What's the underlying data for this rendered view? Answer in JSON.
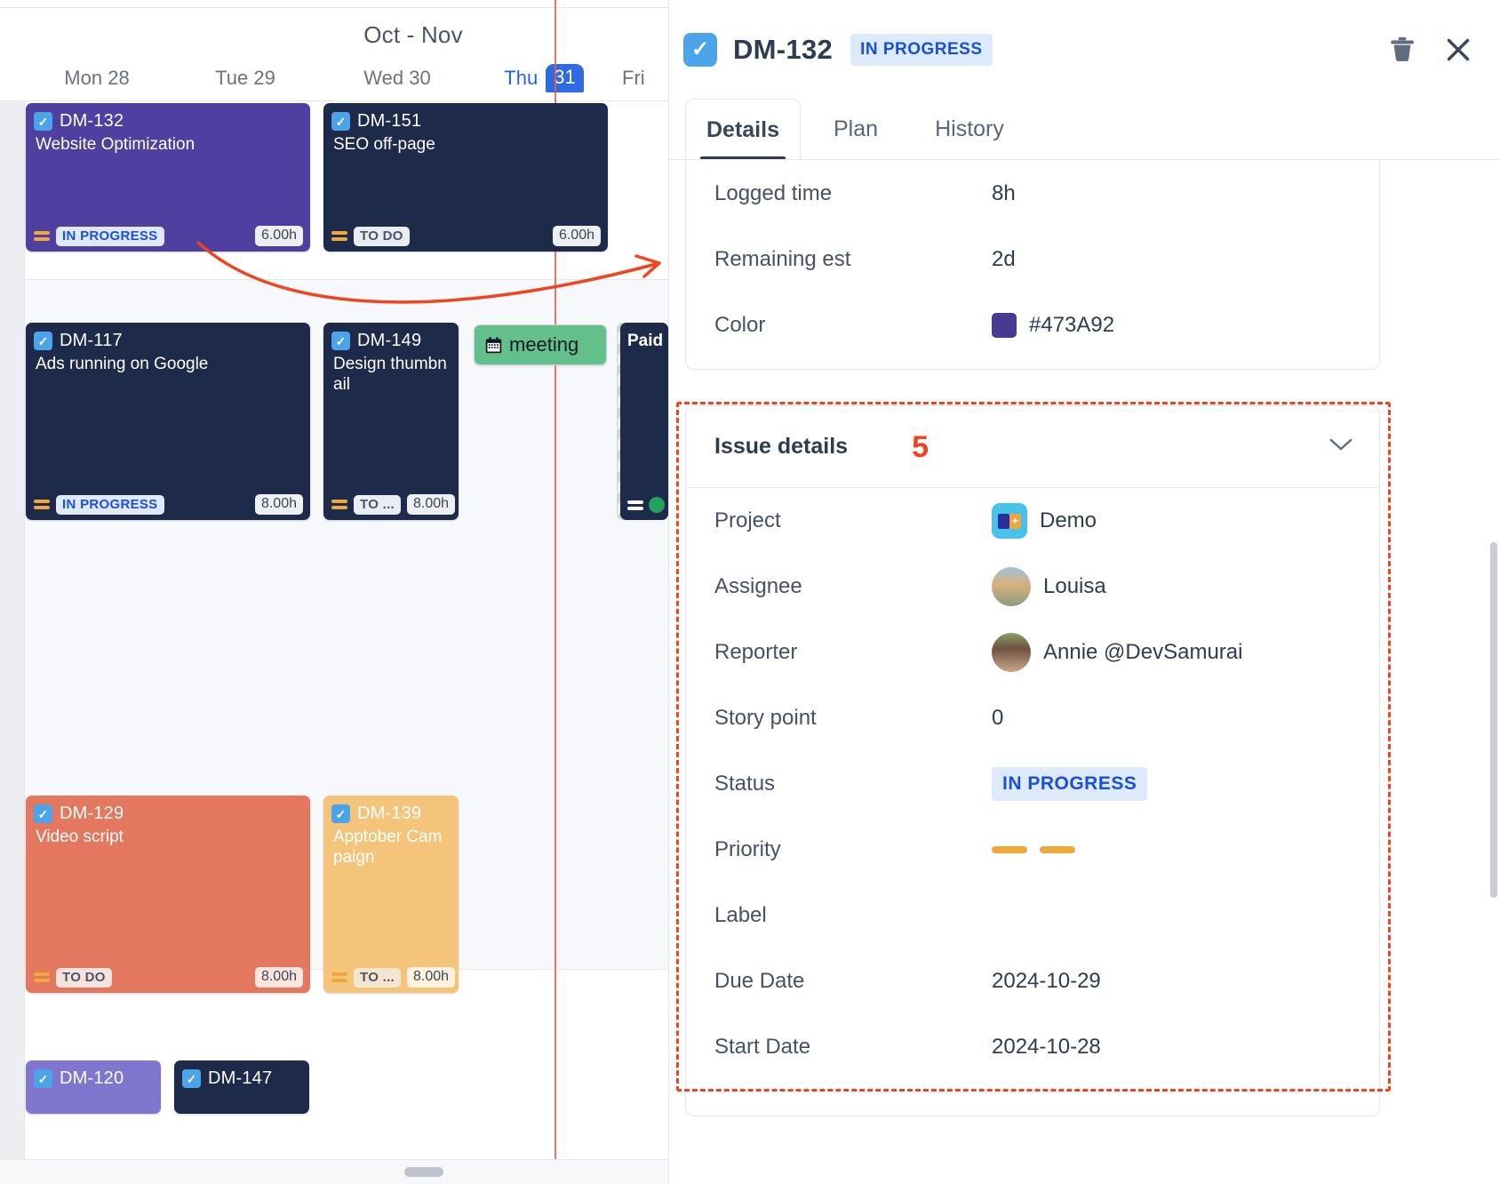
{
  "calendar": {
    "title": "Oct - Nov",
    "days": [
      {
        "name": "Mon",
        "num": "28",
        "today": false
      },
      {
        "name": "Tue",
        "num": "29",
        "today": false
      },
      {
        "name": "Wed",
        "num": "30",
        "today": false
      },
      {
        "name": "Thu",
        "num": "31",
        "today": true
      },
      {
        "name": "Fri",
        "num": "",
        "today": false
      }
    ],
    "cards": [
      {
        "key": "DM-132",
        "summary": "Website Optimization",
        "status": "IN PROGRESS",
        "hours": "6.00h",
        "color": "#4e3fa0"
      },
      {
        "key": "DM-151",
        "summary": "SEO off-page",
        "status": "TO DO",
        "hours": "6.00h",
        "color": "#1d2a4a"
      },
      {
        "key": "DM-117",
        "summary": "Ads running on Google",
        "status": "IN PROGRESS",
        "hours": "8.00h",
        "color": "#1d2a4a"
      },
      {
        "key": "DM-149",
        "summary": "Design thumbnail",
        "status": "TO ...",
        "hours": "8.00h",
        "color": "#1d2a4a"
      },
      {
        "key": "DM-129",
        "summary": "Video script",
        "status": "TO DO",
        "hours": "8.00h",
        "color": "#e3785e"
      },
      {
        "key": "DM-139",
        "summary": "Apptober Campaign",
        "status": "TO ...",
        "hours": "8.00h",
        "color": "#f4c47b"
      },
      {
        "key": "DM-120",
        "summary": "",
        "status": "",
        "hours": "",
        "color": "#8076d0"
      },
      {
        "key": "DM-147",
        "summary": "",
        "status": "",
        "hours": "",
        "color": "#1d2a4a"
      }
    ],
    "event": {
      "label": "meeting",
      "icon": "calendar-icon"
    },
    "paid_card_label": "Paid"
  },
  "panel": {
    "header": {
      "key": "DM-132",
      "status": "IN PROGRESS",
      "delete_icon": "trash-icon",
      "close_icon": "close-icon",
      "check_icon": "check-icon"
    },
    "tabs": [
      {
        "label": "Details",
        "active": true
      },
      {
        "label": "Plan",
        "active": false
      },
      {
        "label": "History",
        "active": false
      }
    ],
    "time_group": [
      {
        "label": "Logged time",
        "value": "8h"
      },
      {
        "label": "Remaining est",
        "value": "2d"
      },
      {
        "label": "Color",
        "value": "#473A92",
        "swatch": "#473A92"
      }
    ],
    "issue_details": {
      "title": "Issue details",
      "annotation": "5",
      "collapse_icon": "chevron-down-icon",
      "rows": [
        {
          "label": "Project",
          "value": "Demo",
          "kind": "project"
        },
        {
          "label": "Assignee",
          "value": "Louisa",
          "kind": "avatar-louisa"
        },
        {
          "label": "Reporter",
          "value": "Annie @DevSamurai",
          "kind": "avatar-annie"
        },
        {
          "label": "Story point",
          "value": "0",
          "kind": "text"
        },
        {
          "label": "Status",
          "value": "IN PROGRESS",
          "kind": "status"
        },
        {
          "label": "Priority",
          "value": "",
          "kind": "priority"
        },
        {
          "label": "Label",
          "value": "",
          "kind": "text"
        },
        {
          "label": "Due Date",
          "value": "2024-10-29",
          "kind": "text"
        },
        {
          "label": "Start Date",
          "value": "2024-10-28",
          "kind": "text"
        }
      ]
    }
  },
  "colors": {
    "accent_blue": "#2d6ae3",
    "annotation_red": "#f2431f",
    "now_line": "#f2594a",
    "issue_color": "#473A92"
  }
}
